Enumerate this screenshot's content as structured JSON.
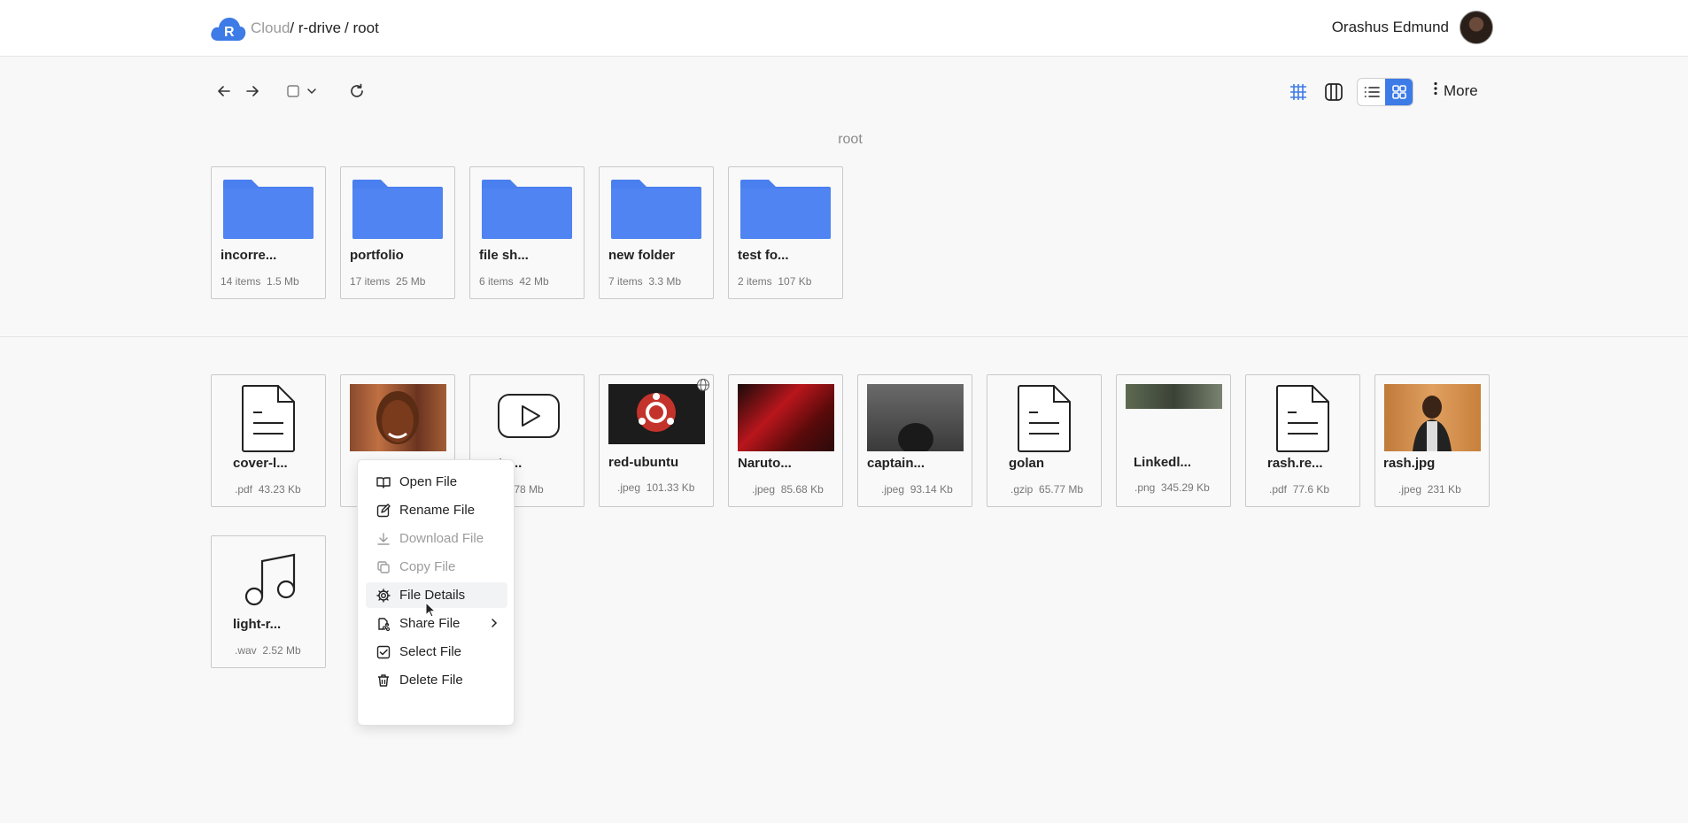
{
  "header": {
    "logo_letter": "R",
    "crumbs": [
      "Cloud",
      "/ r-drive",
      "/ root"
    ],
    "user_name": "Orashus Edmund"
  },
  "toolbar": {
    "more_label": "More",
    "icons": [
      "arrow-left-icon",
      "arrow-right-icon",
      "checkbox-icon",
      "chevron-down-icon",
      "refresh-icon",
      "grid-view-icon",
      "columns-view-icon",
      "list-view-icon",
      "tiles-view-icon",
      "kebab-icon"
    ]
  },
  "section_title": "root",
  "folders": [
    {
      "name": "incorre...",
      "items": "14 items",
      "size": "1.5 Mb"
    },
    {
      "name": "portfolio",
      "items": "17 items",
      "size": "25 Mb"
    },
    {
      "name": "file sh...",
      "items": "6 items",
      "size": "42 Mb"
    },
    {
      "name": "new folder",
      "items": "7 items",
      "size": "3.3 Mb"
    },
    {
      "name": "test fo...",
      "items": "2 items",
      "size": "107 Kb"
    }
  ],
  "files": [
    {
      "name": "cover-l...",
      "ext": ".pdf",
      "size": "43.23 Kb",
      "kind": "doc"
    },
    {
      "name": "",
      "ext": "",
      "size": "",
      "kind": "photo-woman"
    },
    {
      "name": "...uto...",
      "ext": "",
      "size": "57.78 Mb",
      "kind": "video"
    },
    {
      "name": "red-ubuntu",
      "ext": ".jpeg",
      "size": "101.33 Kb",
      "kind": "ubuntu"
    },
    {
      "name": "Naruto...",
      "ext": ".jpeg",
      "size": "85.68 Kb",
      "kind": "naruto"
    },
    {
      "name": "captain...",
      "ext": ".jpeg",
      "size": "93.14 Kb",
      "kind": "captain"
    },
    {
      "name": "golan",
      "ext": ".gzip",
      "size": "65.77 Mb",
      "kind": "doc"
    },
    {
      "name": "Linkedl...",
      "ext": ".png",
      "size": "345.29 Kb",
      "kind": "linkedin"
    },
    {
      "name": "rash.re...",
      "ext": ".pdf",
      "size": "77.6 Kb",
      "kind": "doc"
    },
    {
      "name": "rash.jpg",
      "ext": ".jpeg",
      "size": "231 Kb",
      "kind": "rash"
    },
    {
      "name": "light-r...",
      "ext": ".wav",
      "size": "2.52 Mb",
      "kind": "audio"
    }
  ],
  "context_menu": {
    "items": [
      {
        "label": "Open File",
        "icon": "book-open-icon",
        "disabled": false
      },
      {
        "label": "Rename File",
        "icon": "edit-icon",
        "disabled": false
      },
      {
        "label": "Download File",
        "icon": "download-icon",
        "disabled": true
      },
      {
        "label": "Copy File",
        "icon": "copy-icon",
        "disabled": true
      },
      {
        "label": "File Details",
        "icon": "gear-icon",
        "disabled": false
      },
      {
        "label": "Share File",
        "icon": "share-icon",
        "disabled": false
      },
      {
        "label": "Select File",
        "icon": "checkbox-checked-icon",
        "disabled": false
      },
      {
        "label": "Delete File",
        "icon": "trash-icon",
        "disabled": false
      }
    ]
  },
  "colors": {
    "accent": "#3d7be6",
    "folder": "#4a7ff0"
  }
}
